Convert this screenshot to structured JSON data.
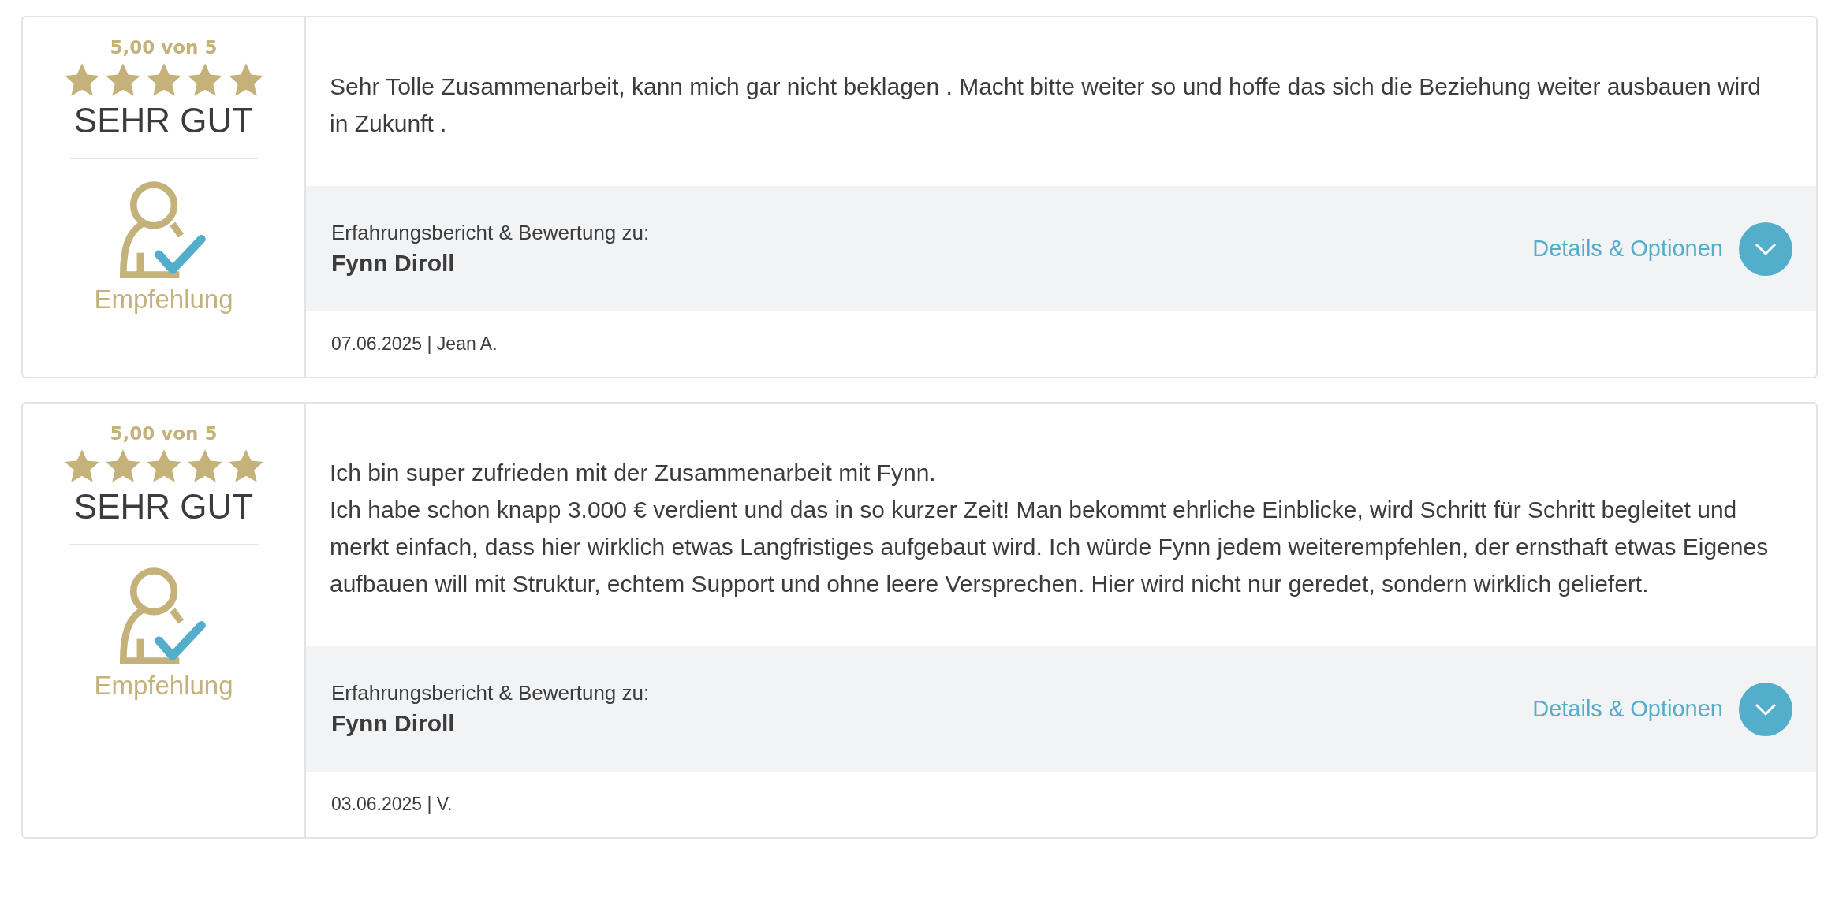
{
  "reviews": [
    {
      "score": "5,00 von 5",
      "stars": 5,
      "rating_label": "SEHR GUT",
      "recommendation": "Empfehlung",
      "text": "Sehr Tolle Zusammenarbeit, kann mich gar nicht beklagen . Macht bitte weiter so und hoffe das sich die Beziehung weiter ausbauen wird in Zukunft .",
      "subject_label": "Erfahrungsbericht & Bewertung zu:",
      "subject_name": "Fynn Diroll",
      "details_link": "Details & Optionen",
      "footer": "07.06.2025 | Jean A."
    },
    {
      "score": "5,00 von 5",
      "stars": 5,
      "rating_label": "SEHR GUT",
      "recommendation": "Empfehlung",
      "text": "Ich bin super zufrieden mit der Zusammenarbeit mit Fynn.\nIch habe schon knapp 3.000 € verdient und das in so kurzer Zeit! Man bekommt ehrliche Einblicke, wird Schritt für Schritt begleitet und merkt einfach, dass hier wirklich etwas Langfristiges aufgebaut wird. Ich würde Fynn jedem weiterempfehlen, der ernsthaft etwas Eigenes aufbauen will mit Struktur, echtem Support und ohne leere Versprechen. Hier wird nicht nur geredet, sondern wirklich geliefert.",
      "subject_label": "Erfahrungsbericht & Bewertung zu:",
      "subject_name": "Fynn Diroll",
      "details_link": "Details & Optionen",
      "footer": "03.06.2025 | V."
    }
  ]
}
